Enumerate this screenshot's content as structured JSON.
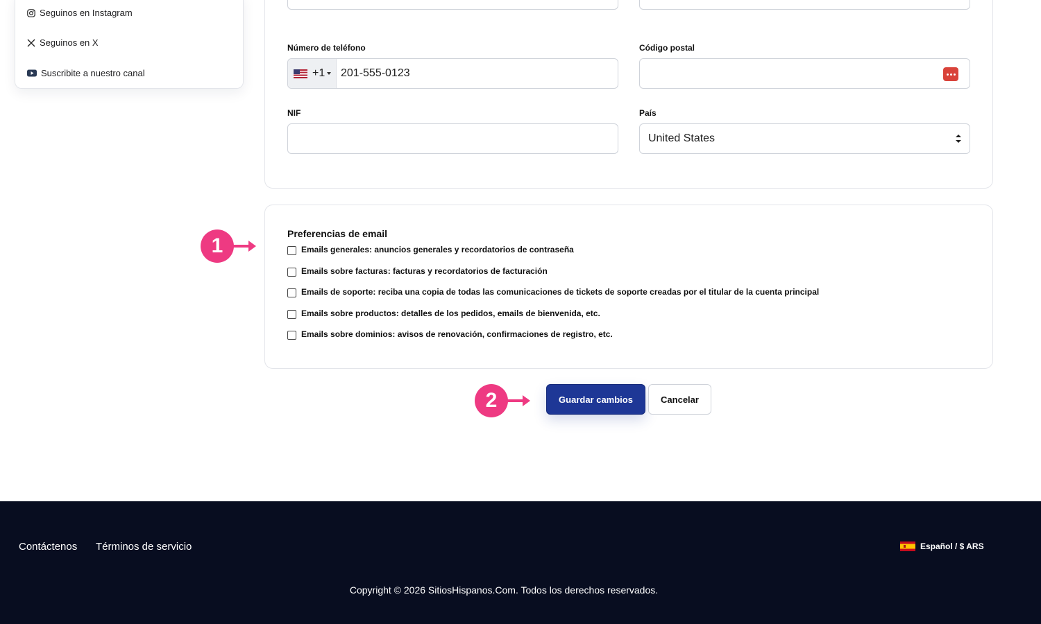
{
  "sidebar": {
    "links": [
      {
        "label": "Seguinos en Instagram",
        "icon": "instagram-icon"
      },
      {
        "label": "Seguinos en X",
        "icon": "x-icon"
      },
      {
        "label": "Suscribite a nuestro canal",
        "icon": "youtube-icon"
      }
    ]
  },
  "form": {
    "top_left_value": "",
    "top_right_value": "—",
    "phone": {
      "label": "Número de teléfono",
      "country_code": "+1",
      "value": "201-555-0123"
    },
    "postal": {
      "label": "Código postal",
      "value": ""
    },
    "nif": {
      "label": "NIF",
      "value": ""
    },
    "country": {
      "label": "País",
      "value": "United States"
    }
  },
  "email_prefs": {
    "title": "Preferencias de email",
    "options": [
      {
        "label": "Emails generales: anuncios generales y recordatorios de contraseña",
        "checked": false
      },
      {
        "label": "Emails sobre facturas: facturas y recordatorios de facturación",
        "checked": false
      },
      {
        "label": "Emails de soporte: reciba una copia de todas las comunicaciones de tickets de soporte creadas por el titular de la cuenta principal",
        "checked": false
      },
      {
        "label": "Emails sobre productos: detalles de los pedidos, emails de bienvenida, etc.",
        "checked": false
      },
      {
        "label": "Emails sobre dominios: avisos de renovación, confirmaciones de registro, etc.",
        "checked": false
      }
    ]
  },
  "callouts": {
    "first": "1",
    "second": "2",
    "color": "#ee3a82"
  },
  "actions": {
    "save_label": "Guardar cambios",
    "cancel_label": "Cancelar",
    "primary_color": "#1e3796"
  },
  "footer": {
    "links": [
      "Contáctenos",
      "Términos de servicio"
    ],
    "language": "Español / $ ARS",
    "copyright": "Copyright © 2026 SitiosHispanos.Com. Todos los derechos reservados.",
    "background": "#080d20"
  }
}
